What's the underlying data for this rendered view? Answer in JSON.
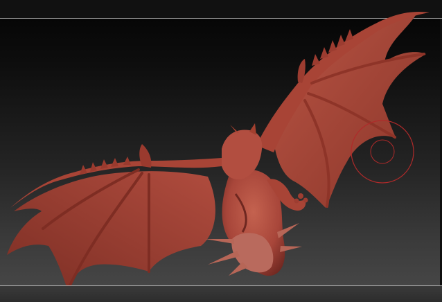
{
  "app": "sculpting-viewport",
  "canvas": {
    "background_gradient": [
      "#030303",
      "#4a4a4a"
    ],
    "frame_line_color": "#a0a0a0"
  },
  "model": {
    "subject": "dragon-sculpt",
    "material_color": "#a8463a",
    "shadow_color": "#5a1e18",
    "highlight_color": "#c96a5a"
  },
  "brush": {
    "icon": "brush-cursor-icon",
    "color": "#b02a2a"
  }
}
